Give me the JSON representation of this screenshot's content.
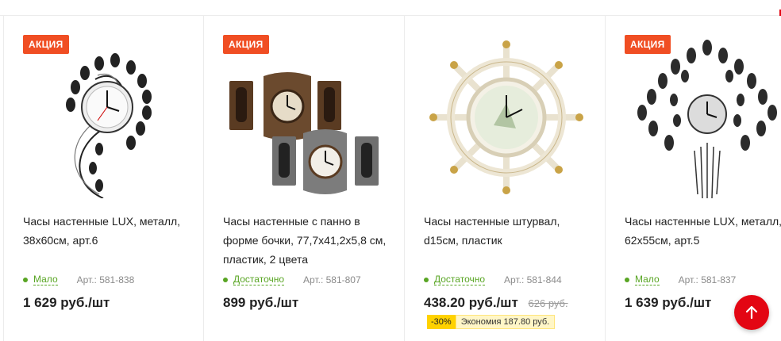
{
  "products": [
    {
      "badge": "АКЦИЯ",
      "title": "Часы настенные LUX, металл, 38х60см, арт.6",
      "stock": "Мало",
      "article": "Арт.: 581-838",
      "price": "1 629 руб./шт"
    },
    {
      "badge": "АКЦИЯ",
      "title": "Часы настенные с панно в форме бочки, 77,7х41,2х5,8 см, пластик, 2 цвета",
      "stock": "Достаточно",
      "article": "Арт.: 581-807",
      "price": "899 руб./шт"
    },
    {
      "title": "Часы настенные штурвал, d15см, пластик",
      "stock": "Достаточно",
      "article": "Арт.: 581-844",
      "price": "438.20 руб./шт",
      "old_price": "626 руб.",
      "discount": "-30%",
      "savings": "Экономия 187.80 руб."
    },
    {
      "badge": "АКЦИЯ",
      "title": "Часы настенные LUX, металл, 62х55см, арт.5",
      "stock": "Мало",
      "article": "Арт.: 581-837",
      "price": "1 639 руб./шт"
    }
  ],
  "colors": {
    "badge": "#f04e23",
    "stock_green": "#58a523",
    "scroll_button": "#e30613",
    "discount_yellow": "#ffd200"
  },
  "icons": {
    "scroll_top": "arrow-up-icon",
    "stock": "dot-icon"
  }
}
